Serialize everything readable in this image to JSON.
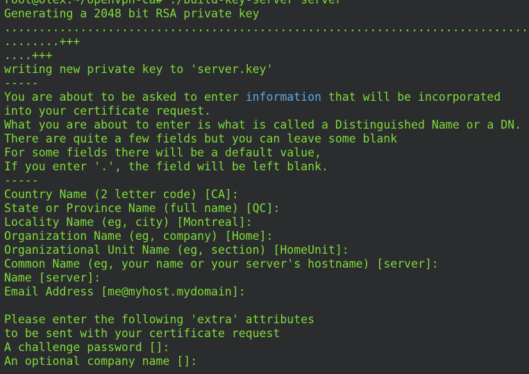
{
  "terminal": {
    "lines": [
      {
        "text": "root@olex:~/openvpn-ca# ./build-key-server server"
      },
      {
        "text": "Generating a 2048 bit RSA private key"
      },
      {
        "text": "............................................................................"
      },
      {
        "text": "........+++"
      },
      {
        "text": "....+++"
      },
      {
        "text": "writing new private key to 'server.key'"
      },
      {
        "text": "-----"
      },
      {
        "text_before": "You are about to be asked to enter ",
        "highlight": "information",
        "text_after": " that will be incorporated"
      },
      {
        "text": "into your certificate request."
      },
      {
        "text": "What you are about to enter is what is called a Distinguished Name or a DN."
      },
      {
        "text": "There are quite a few fields but you can leave some blank"
      },
      {
        "text": "For some fields there will be a default value,"
      },
      {
        "text": "If you enter '.', the field will be left blank."
      },
      {
        "text": "-----"
      },
      {
        "text": "Country Name (2 letter code) [CA]:"
      },
      {
        "text": "State or Province Name (full name) [QC]:"
      },
      {
        "text": "Locality Name (eg, city) [Montreal]:"
      },
      {
        "text": "Organization Name (eg, company) [Home]:"
      },
      {
        "text": "Organizational Unit Name (eg, section) [HomeUnit]:"
      },
      {
        "text": "Common Name (eg, your name or your server's hostname) [server]:"
      },
      {
        "text": "Name [server]:"
      },
      {
        "text": "Email Address [me@myhost.mydomain]:"
      },
      {
        "text": ""
      },
      {
        "text": "Please enter the following 'extra' attributes"
      },
      {
        "text": "to be sent with your certificate request"
      },
      {
        "text": "A challenge password []:"
      },
      {
        "text": "An optional company name []:"
      }
    ]
  },
  "colors": {
    "background": "#2b2c2e",
    "text": "#7fdc3a",
    "highlight": "#5aa9e6"
  }
}
